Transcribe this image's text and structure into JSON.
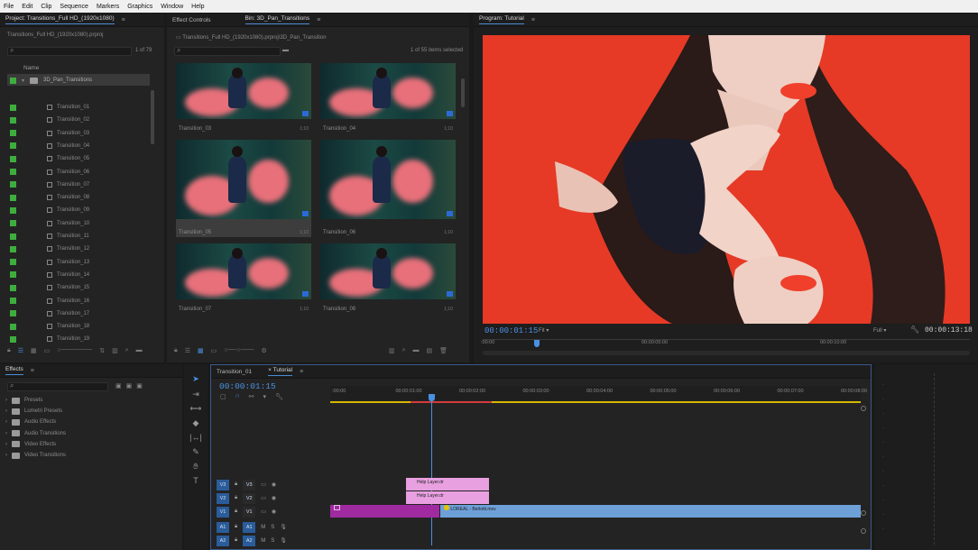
{
  "menu": [
    "File",
    "Edit",
    "Clip",
    "Sequence",
    "Markers",
    "Graphics",
    "Window",
    "Help"
  ],
  "project": {
    "title": "Project: Transitions_Full HD_(1920x1080)",
    "subpath": "Transitions_Full HD_(1920x1080).prproj",
    "count": "1 of 79",
    "column_name": "Name",
    "folder": "3D_Pan_Transitions",
    "items": [
      "Transition_01",
      "Transition_02",
      "Transition_03",
      "Transition_04",
      "Transition_05",
      "Transition_06",
      "Transition_07",
      "Transition_08",
      "Transition_09",
      "Transition_10",
      "Transition_11",
      "Transition_12",
      "Transition_13",
      "Transition_14",
      "Transition_15",
      "Transition_16",
      "Transition_17",
      "Transition_18",
      "Transition_19"
    ]
  },
  "bin": {
    "tab_effect_controls": "Effect Controls",
    "tab_bin": "Bin: 3D_Pan_Transitions",
    "path": "Transitions_Full HD_(1920x1080).prproj\\3D_Pan_Transition",
    "selected": "1 of 55 items selected",
    "thumbs": [
      {
        "label": "Transition_03",
        "dur": "1;10"
      },
      {
        "label": "Transition_04",
        "dur": "1;10"
      },
      {
        "label": "Transition_05",
        "dur": "1;10"
      },
      {
        "label": "Transition_06",
        "dur": "1;10"
      },
      {
        "label": "Transition_07",
        "dur": "1;10"
      },
      {
        "label": "Transition_08",
        "dur": "1;10"
      }
    ]
  },
  "program": {
    "title": "Program: Tutorial",
    "timecode": "00:00:01:15",
    "fit": "Fit",
    "quality": "Full",
    "duration": "00:00:13:18",
    "ruler": [
      ":00:00",
      "00:00:05:00",
      "00:00:10:00"
    ]
  },
  "effects": {
    "title": "Effects",
    "items": [
      "Presets",
      "Lumetri Presets",
      "Audio Effects",
      "Audio Transitions",
      "Video Effects",
      "Video Transitions"
    ]
  },
  "timeline": {
    "tab1": "Transition_01",
    "tab2": "Tutorial",
    "timecode": "00:00:01:15",
    "ruler": [
      ":00:00",
      "00:00:01:00",
      "00:00:02:00",
      "00:00:03:00",
      "00:00:04:00",
      "00:00:05:00",
      "00:00:06:00",
      "00:00:07:00",
      "00:00:08:00"
    ],
    "tracks": [
      {
        "src": "V3",
        "name": "V3"
      },
      {
        "src": "V2",
        "name": "V2"
      },
      {
        "src": "V1",
        "name": "V1"
      },
      {
        "src": "A1",
        "name": "A1",
        "m": "M",
        "s": "S"
      },
      {
        "src": "A2",
        "name": "A2",
        "m": "M",
        "s": "S"
      }
    ],
    "clip_v3": "Help Layer.dr",
    "clip_v2": "Help Layer.dr",
    "clip_v1_main": "LOREAL - Berlotti.mov"
  },
  "colors": {
    "accent": "#4a90e2",
    "label_green": "#3dae3d",
    "adjust_clip": "#e8a0e0",
    "v1_magenta": "#a02aa0",
    "v1_blue": "#6ea0d8",
    "video_red": "#e8412c"
  }
}
